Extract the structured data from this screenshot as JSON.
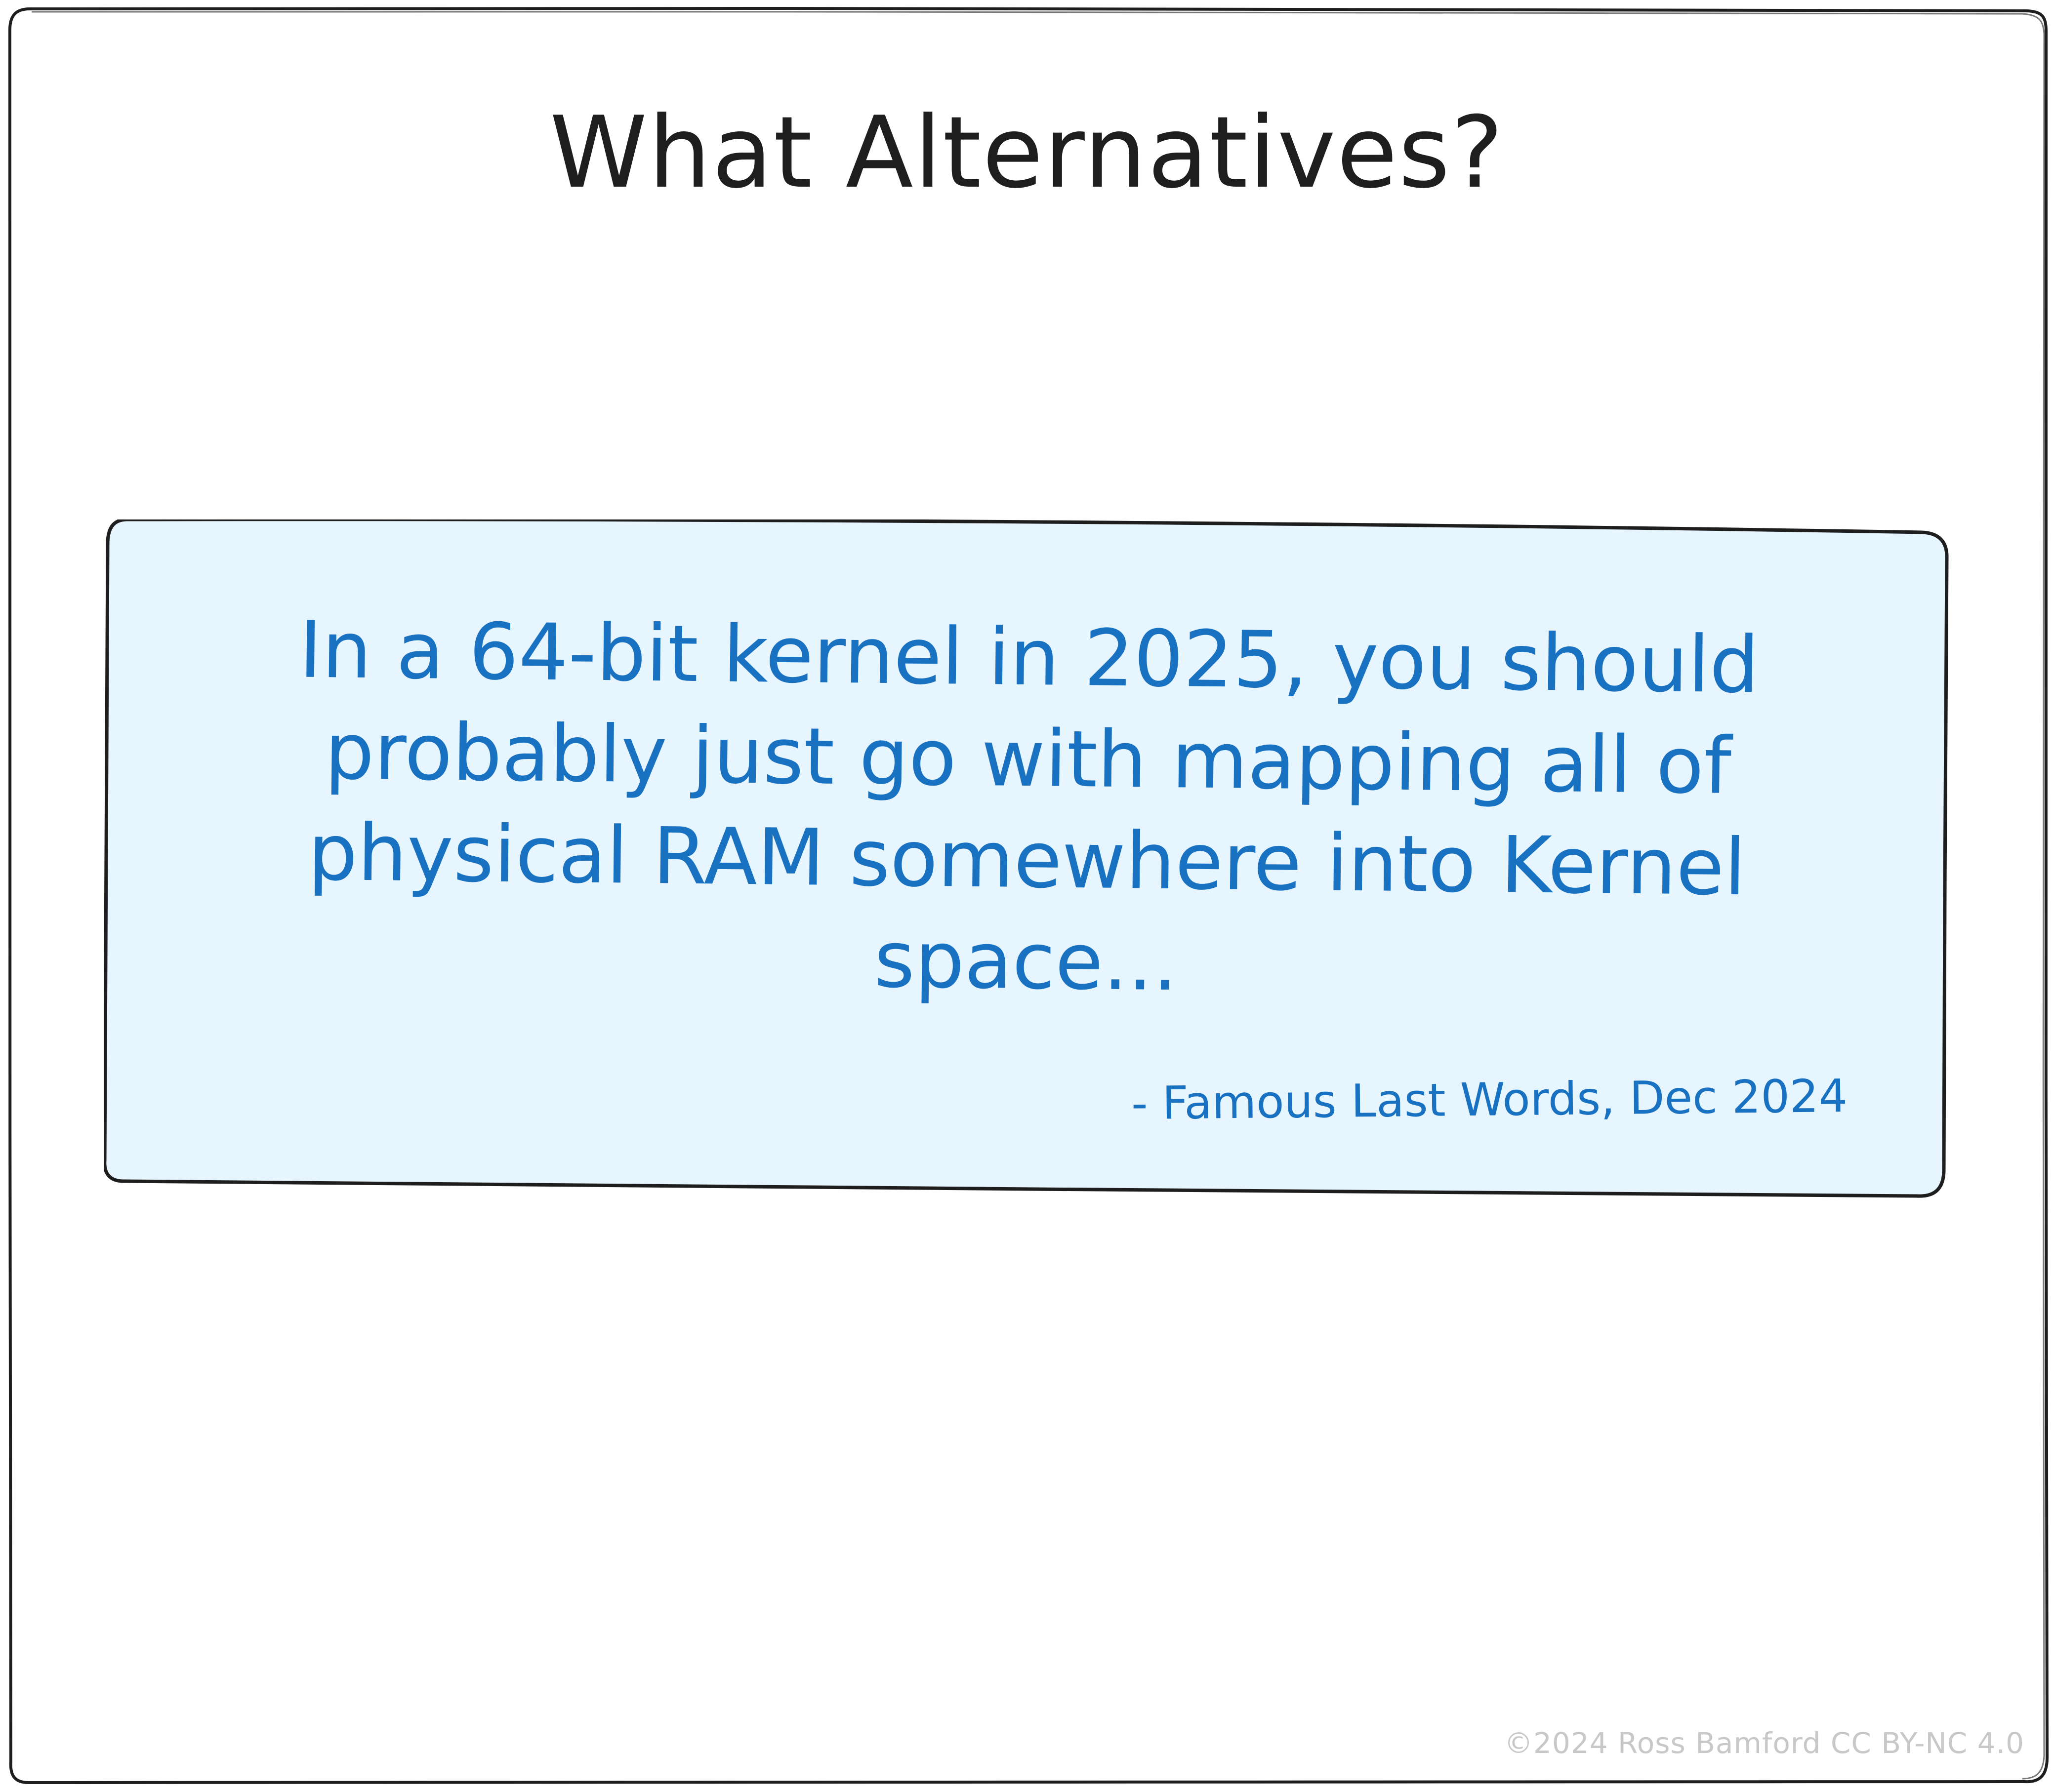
{
  "title": "What Alternatives?",
  "quote": {
    "text": "In a 64-bit kernel in 2025, you should probably just go with mapping all of physical RAM somewhere into Kernel space...",
    "attribution": "- Famous Last Words, Dec 2024"
  },
  "footer": {
    "copyright": "©2024 Ross Bamford CC BY-NC 4.0"
  },
  "colors": {
    "outline": "#1e1e1e",
    "quote_text": "#1971c2",
    "quote_fill": "#e7f5ff",
    "footer_text": "#c8c8c8"
  }
}
